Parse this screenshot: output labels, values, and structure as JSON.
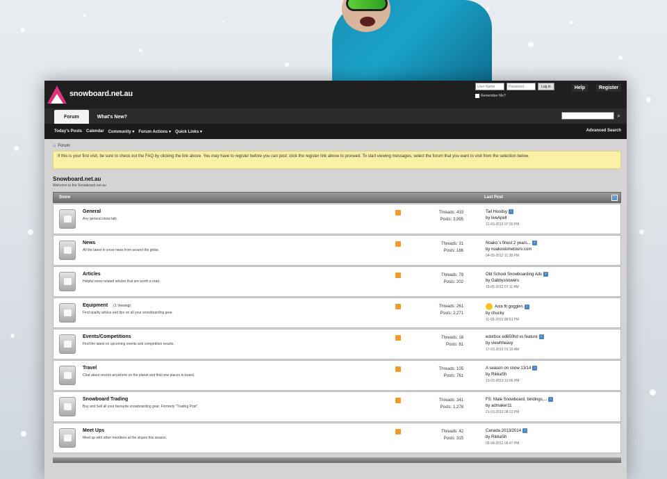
{
  "header": {
    "logo_text": "snowboard.net.au",
    "username_placeholder": "User Name",
    "password_placeholder": "Password",
    "login_label": "Log in",
    "remember_label": "Remember Me?",
    "help_label": "Help",
    "register_label": "Register"
  },
  "nav": {
    "tabs": [
      {
        "label": "Forum",
        "active": true
      },
      {
        "label": "What's New?",
        "active": false
      }
    ],
    "subnav": [
      "Today's Posts",
      "Calendar",
      "Community ▾",
      "Forum Actions ▾",
      "Quick Links ▾"
    ],
    "advanced_search": "Advanced Search"
  },
  "breadcrumb": "Forum",
  "notice": "If this is your first visit, be sure to check out the FAQ by clicking the link above. You may have to register before you can post: click the register link above to proceed. To start viewing messages, select the forum that you want to visit from the selection below.",
  "site": {
    "title": "Snowboard.net.au",
    "subtitle": "Welcome to the Snowboard.net.au"
  },
  "category": {
    "title": "Snow",
    "last_post_header": "Last Post",
    "forums": [
      {
        "name": "General",
        "viewing": "",
        "desc": "Any general snow talk.",
        "threads": "Threads: 433",
        "posts": "Posts: 3,995",
        "last_title": "Tail Hoodsy",
        "last_by": "by liveApell",
        "last_date": "21-03-2013 07:30 PM",
        "smile": false
      },
      {
        "name": "News",
        "viewing": "",
        "desc": "All the latest in snow news from around the globe.",
        "threads": "Threads: 31",
        "posts": "Posts: 186",
        "last_title": "Noako`s finest 2 years...",
        "last_by": "by noakoskimetours.com",
        "last_date": "04-05-2012 11:38 PM",
        "smile": false
      },
      {
        "name": "Articles",
        "viewing": "",
        "desc": "Helpful snow related articles that are worth a read.",
        "threads": "Threads: 79",
        "posts": "Posts: 202",
        "last_title": "Old School Snowboarding Ads",
        "last_by": "by Gabbysnowers",
        "last_date": "15-05-2012 07:11 AM",
        "smile": false
      },
      {
        "name": "Equipment",
        "viewing": "(1 Viewing)",
        "desc": "Find quality advice and tips on all your snowboarding gear.",
        "threads": "Threads: 261",
        "posts": "Posts: 2,271",
        "last_title": "Asia fit goggles",
        "last_by": "by chucky",
        "last_date": "11-03-2013 08:53 PM",
        "smile": true
      },
      {
        "name": "Events/Competitions",
        "viewing": "",
        "desc": "Find the latest on upcoming events and competition results.",
        "threads": "Threads: 18",
        "posts": "Posts: 81",
        "last_title": "edorbox ed650hd vs feature",
        "last_by": "by viewhheavy",
        "last_date": "17-03-2013 01:16 AM",
        "smile": false
      },
      {
        "name": "Travel",
        "viewing": "",
        "desc": "Chat about resorts anywhere on the planet and find new places to board.",
        "threads": "Threads: 105",
        "posts": "Posts: 761",
        "last_title": "A season on snow 13/14",
        "last_by": "by RikkaSh",
        "last_date": "13-03-2013 10:06 PM",
        "smile": false
      },
      {
        "name": "Snowboard Trading",
        "viewing": "",
        "desc": "Buy and Sell all your favourite snowboarding gear. Formerly \"Trading Post\".",
        "threads": "Threads: 341",
        "posts": "Posts: 1,278",
        "last_title": "FS: Male Snowboard, bindings,...",
        "last_by": "by admaker11",
        "last_date": "21-03-2013 08:13 PM",
        "smile": false
      },
      {
        "name": "Meet Ups",
        "viewing": "",
        "desc": "Meet up with other members at the slopes this season.",
        "threads": "Threads: 42",
        "posts": "Posts: 315",
        "last_title": "Canada 2013/2014",
        "last_by": "by RikkaSh",
        "last_date": "05-04-2013 06:47 PM",
        "smile": false
      }
    ]
  }
}
